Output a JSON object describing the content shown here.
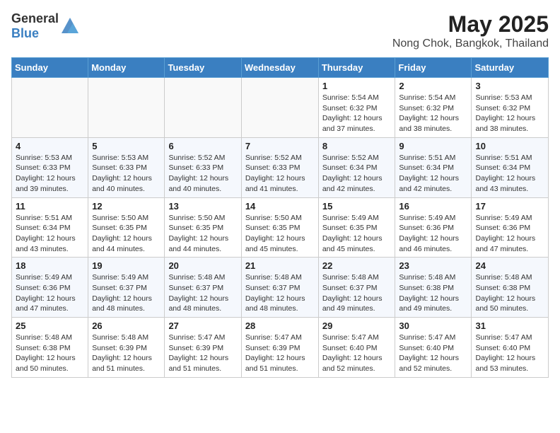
{
  "header": {
    "logo_general": "General",
    "logo_blue": "Blue",
    "title": "May 2025",
    "subtitle": "Nong Chok, Bangkok, Thailand"
  },
  "weekdays": [
    "Sunday",
    "Monday",
    "Tuesday",
    "Wednesday",
    "Thursday",
    "Friday",
    "Saturday"
  ],
  "weeks": [
    [
      {
        "day": "",
        "info": ""
      },
      {
        "day": "",
        "info": ""
      },
      {
        "day": "",
        "info": ""
      },
      {
        "day": "",
        "info": ""
      },
      {
        "day": "1",
        "info": "Sunrise: 5:54 AM\nSunset: 6:32 PM\nDaylight: 12 hours\nand 37 minutes."
      },
      {
        "day": "2",
        "info": "Sunrise: 5:54 AM\nSunset: 6:32 PM\nDaylight: 12 hours\nand 38 minutes."
      },
      {
        "day": "3",
        "info": "Sunrise: 5:53 AM\nSunset: 6:32 PM\nDaylight: 12 hours\nand 38 minutes."
      }
    ],
    [
      {
        "day": "4",
        "info": "Sunrise: 5:53 AM\nSunset: 6:33 PM\nDaylight: 12 hours\nand 39 minutes."
      },
      {
        "day": "5",
        "info": "Sunrise: 5:53 AM\nSunset: 6:33 PM\nDaylight: 12 hours\nand 40 minutes."
      },
      {
        "day": "6",
        "info": "Sunrise: 5:52 AM\nSunset: 6:33 PM\nDaylight: 12 hours\nand 40 minutes."
      },
      {
        "day": "7",
        "info": "Sunrise: 5:52 AM\nSunset: 6:33 PM\nDaylight: 12 hours\nand 41 minutes."
      },
      {
        "day": "8",
        "info": "Sunrise: 5:52 AM\nSunset: 6:34 PM\nDaylight: 12 hours\nand 42 minutes."
      },
      {
        "day": "9",
        "info": "Sunrise: 5:51 AM\nSunset: 6:34 PM\nDaylight: 12 hours\nand 42 minutes."
      },
      {
        "day": "10",
        "info": "Sunrise: 5:51 AM\nSunset: 6:34 PM\nDaylight: 12 hours\nand 43 minutes."
      }
    ],
    [
      {
        "day": "11",
        "info": "Sunrise: 5:51 AM\nSunset: 6:34 PM\nDaylight: 12 hours\nand 43 minutes."
      },
      {
        "day": "12",
        "info": "Sunrise: 5:50 AM\nSunset: 6:35 PM\nDaylight: 12 hours\nand 44 minutes."
      },
      {
        "day": "13",
        "info": "Sunrise: 5:50 AM\nSunset: 6:35 PM\nDaylight: 12 hours\nand 44 minutes."
      },
      {
        "day": "14",
        "info": "Sunrise: 5:50 AM\nSunset: 6:35 PM\nDaylight: 12 hours\nand 45 minutes."
      },
      {
        "day": "15",
        "info": "Sunrise: 5:49 AM\nSunset: 6:35 PM\nDaylight: 12 hours\nand 45 minutes."
      },
      {
        "day": "16",
        "info": "Sunrise: 5:49 AM\nSunset: 6:36 PM\nDaylight: 12 hours\nand 46 minutes."
      },
      {
        "day": "17",
        "info": "Sunrise: 5:49 AM\nSunset: 6:36 PM\nDaylight: 12 hours\nand 47 minutes."
      }
    ],
    [
      {
        "day": "18",
        "info": "Sunrise: 5:49 AM\nSunset: 6:36 PM\nDaylight: 12 hours\nand 47 minutes."
      },
      {
        "day": "19",
        "info": "Sunrise: 5:49 AM\nSunset: 6:37 PM\nDaylight: 12 hours\nand 48 minutes."
      },
      {
        "day": "20",
        "info": "Sunrise: 5:48 AM\nSunset: 6:37 PM\nDaylight: 12 hours\nand 48 minutes."
      },
      {
        "day": "21",
        "info": "Sunrise: 5:48 AM\nSunset: 6:37 PM\nDaylight: 12 hours\nand 48 minutes."
      },
      {
        "day": "22",
        "info": "Sunrise: 5:48 AM\nSunset: 6:37 PM\nDaylight: 12 hours\nand 49 minutes."
      },
      {
        "day": "23",
        "info": "Sunrise: 5:48 AM\nSunset: 6:38 PM\nDaylight: 12 hours\nand 49 minutes."
      },
      {
        "day": "24",
        "info": "Sunrise: 5:48 AM\nSunset: 6:38 PM\nDaylight: 12 hours\nand 50 minutes."
      }
    ],
    [
      {
        "day": "25",
        "info": "Sunrise: 5:48 AM\nSunset: 6:38 PM\nDaylight: 12 hours\nand 50 minutes."
      },
      {
        "day": "26",
        "info": "Sunrise: 5:48 AM\nSunset: 6:39 PM\nDaylight: 12 hours\nand 51 minutes."
      },
      {
        "day": "27",
        "info": "Sunrise: 5:47 AM\nSunset: 6:39 PM\nDaylight: 12 hours\nand 51 minutes."
      },
      {
        "day": "28",
        "info": "Sunrise: 5:47 AM\nSunset: 6:39 PM\nDaylight: 12 hours\nand 51 minutes."
      },
      {
        "day": "29",
        "info": "Sunrise: 5:47 AM\nSunset: 6:40 PM\nDaylight: 12 hours\nand 52 minutes."
      },
      {
        "day": "30",
        "info": "Sunrise: 5:47 AM\nSunset: 6:40 PM\nDaylight: 12 hours\nand 52 minutes."
      },
      {
        "day": "31",
        "info": "Sunrise: 5:47 AM\nSunset: 6:40 PM\nDaylight: 12 hours\nand 53 minutes."
      }
    ]
  ]
}
